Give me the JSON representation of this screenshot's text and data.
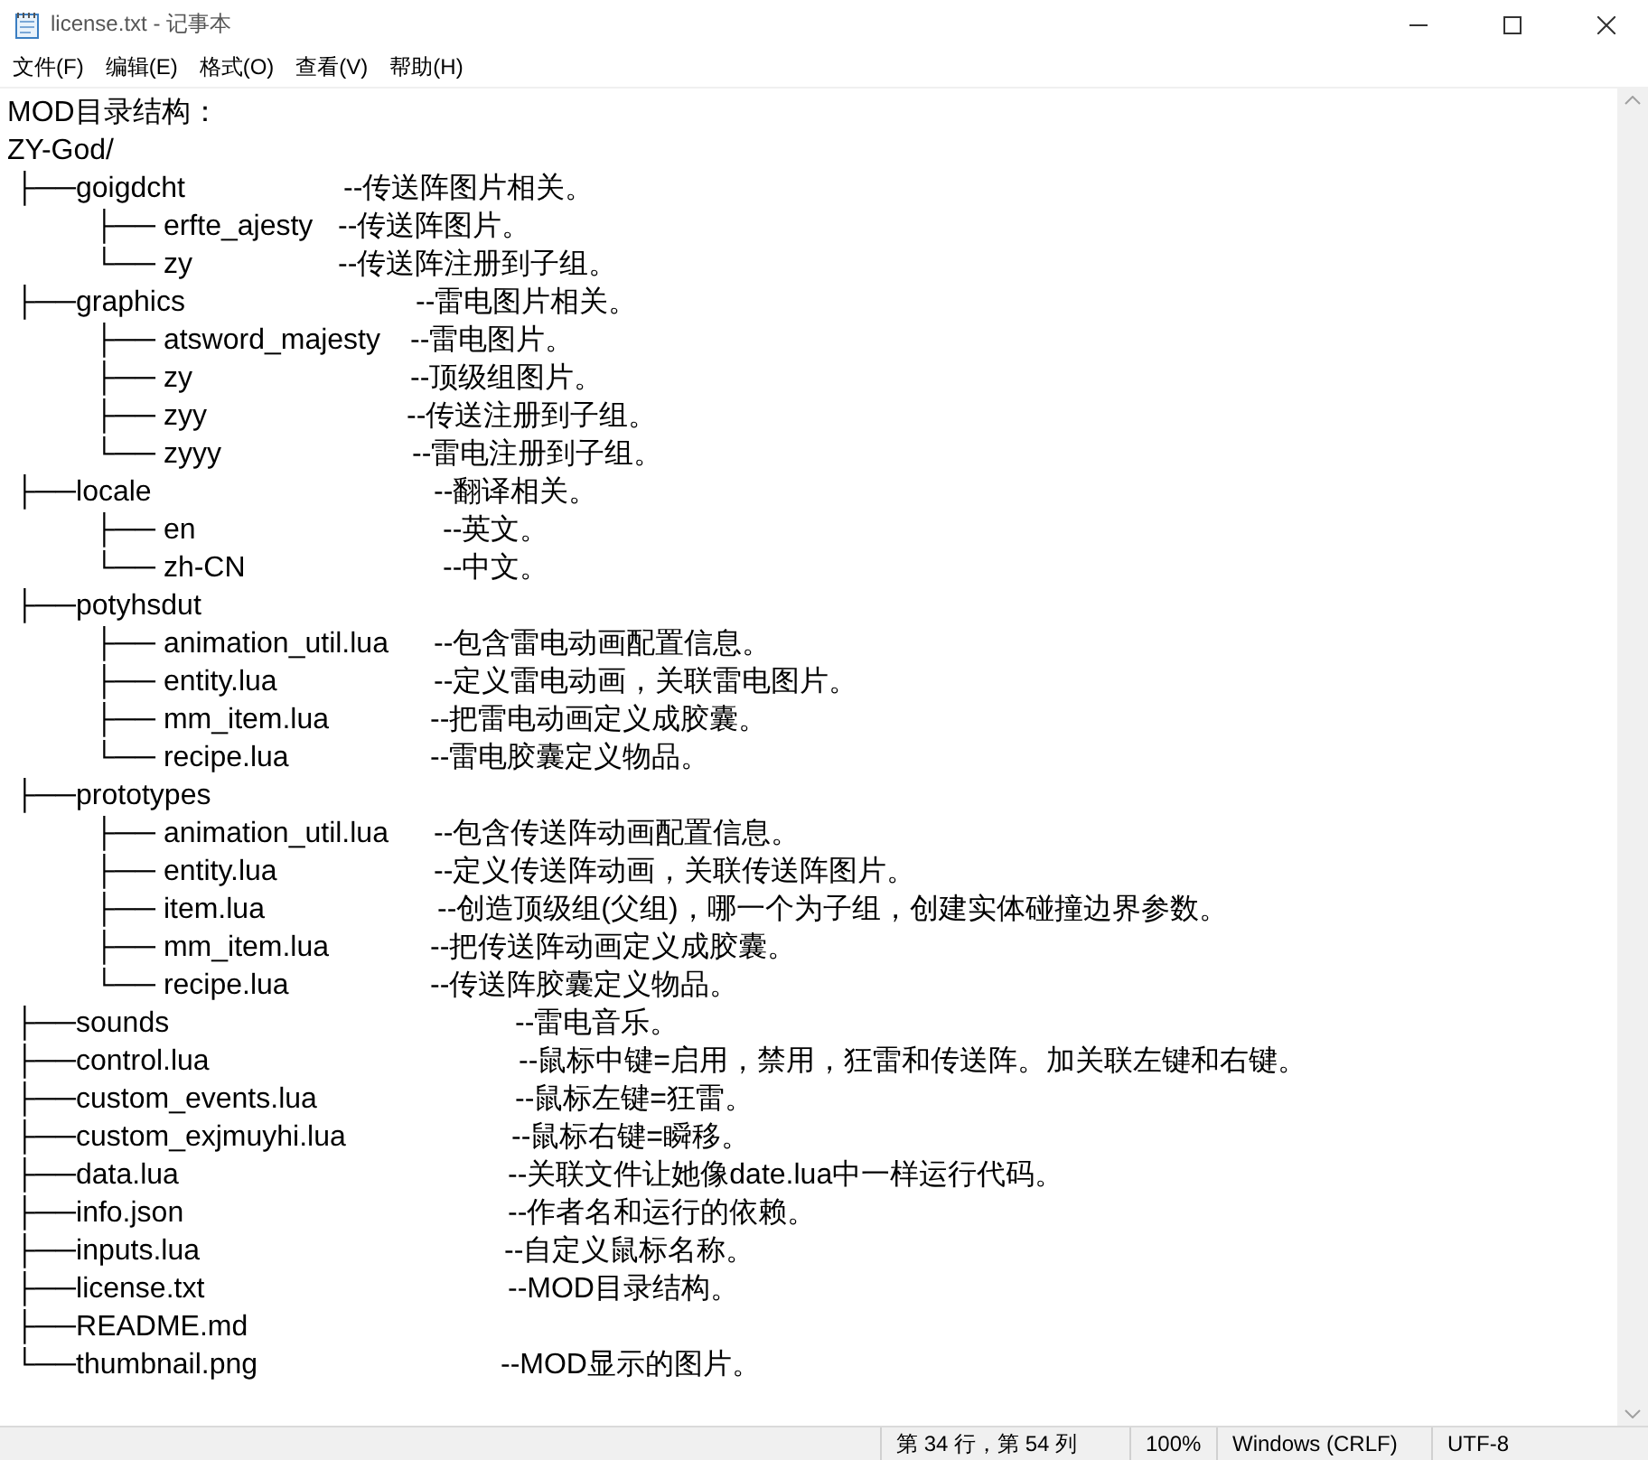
{
  "window": {
    "title": "license.txt - 记事本"
  },
  "menu": [
    "文件(F)",
    "编辑(E)",
    "格式(O)",
    "查看(V)",
    "帮助(H)"
  ],
  "header_lines": [
    "MOD目录结构：",
    "ZY-God/"
  ],
  "tree": [
    {
      "label": "├──goigdcht",
      "comment": "--传送阵图片相关。",
      "children": [
        {
          "label": "├── erfte_ajesty",
          "comment": "--传送阵图片。"
        },
        {
          "label": "└── zy",
          "comment": "--传送阵注册到子组。"
        }
      ]
    },
    {
      "label": "├──graphics",
      "comment": "--雷电图片相关。",
      "children": [
        {
          "label": "├── atsword_majesty",
          "comment": "--雷电图片。"
        },
        {
          "label": "├── zy",
          "comment": "--顶级组图片。"
        },
        {
          "label": "├── zyy",
          "comment": "--传送注册到子组。"
        },
        {
          "label": "└── zyyy",
          "comment": "--雷电注册到子组。"
        }
      ]
    },
    {
      "label": "├──locale",
      "comment": "--翻译相关。",
      "children": [
        {
          "label": "├── en",
          "comment": "--英文。"
        },
        {
          "label": "└── zh-CN",
          "comment": "--中文。"
        }
      ]
    },
    {
      "label": "├──potyhsdut",
      "children": [
        {
          "label": "├── animation_util.lua",
          "comment": "--包含雷电动画配置信息。"
        },
        {
          "label": "├── entity.lua",
          "comment": "--定义雷电动画，关联雷电图片。"
        },
        {
          "label": "├── mm_item.lua",
          "comment": "--把雷电动画定义成胶囊。"
        },
        {
          "label": "└── recipe.lua",
          "comment": "--雷电胶囊定义物品。"
        }
      ]
    },
    {
      "label": "├──prototypes",
      "children": [
        {
          "label": "├── animation_util.lua",
          "comment": "--包含传送阵动画配置信息。"
        },
        {
          "label": "├── entity.lua",
          "comment": "--定义传送阵动画，关联传送阵图片。"
        },
        {
          "label": "├── item.lua",
          "comment": "--创造顶级组(父组)，哪一个为子组，创建实体碰撞边界参数。"
        },
        {
          "label": "├── mm_item.lua",
          "comment": "--把传送阵动画定义成胶囊。"
        },
        {
          "label": "└── recipe.lua",
          "comment": "--传送阵胶囊定义物品。"
        }
      ]
    },
    {
      "label": "├──sounds",
      "comment": "--雷电音乐。"
    },
    {
      "label": "├──control.lua",
      "comment": "--鼠标中键=启用，禁用，狂雷和传送阵。加关联左键和右键。"
    },
    {
      "label": "├──custom_events.lua",
      "comment": "--鼠标左键=狂雷。"
    },
    {
      "label": "├──custom_exjmuyhi.lua",
      "comment": "--鼠标右键=瞬移。"
    },
    {
      "label": "├──data.lua",
      "comment": "--关联文件让她像date.lua中一样运行代码。"
    },
    {
      "label": "├──info.json",
      "comment": "--作者名和运行的依赖。"
    },
    {
      "label": "├──inputs.lua",
      "comment": "--自定义鼠标名称。"
    },
    {
      "label": "├──license.txt",
      "comment": "--MOD目录结构。"
    },
    {
      "label": "├──README.md"
    },
    {
      "label": "└──thumbnail.png",
      "comment": "--MOD显示的图片。"
    }
  ],
  "status_bar": [
    "第 34 行，第 54 列",
    "100%",
    "Windows (CRLF)",
    "UTF-8"
  ]
}
